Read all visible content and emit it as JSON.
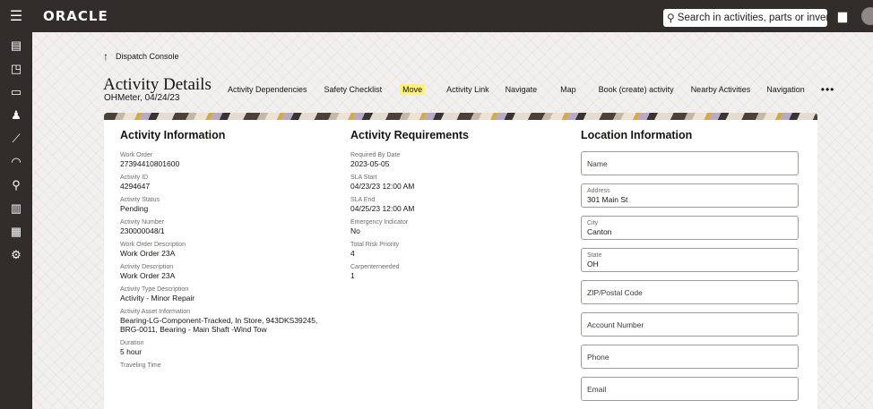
{
  "header": {
    "logo": "ORACLE",
    "search_placeholder": "Search in activities, parts or inventories"
  },
  "breadcrumb": {
    "label": "Dispatch Console"
  },
  "page": {
    "title": "Activity Details",
    "subtitle": "OHMeter, 04/24/23"
  },
  "tabs": [
    {
      "label": "Activity Dependencies"
    },
    {
      "label": "Safety Checklist"
    },
    {
      "label": "Move"
    },
    {
      "label": "Activity Link"
    },
    {
      "label": "Navigate"
    },
    {
      "label": "Map"
    },
    {
      "label": "Book (create) activity"
    },
    {
      "label": "Nearby Activities"
    },
    {
      "label": "Navigation"
    }
  ],
  "more_label": "•••",
  "activity_information": {
    "heading": "Activity Information",
    "fields": [
      {
        "label": "Work Order",
        "value": "27394410801600"
      },
      {
        "label": "Activity ID",
        "value": "4294647"
      },
      {
        "label": "Activity Status",
        "value": "Pending"
      },
      {
        "label": "Activity Number",
        "value": "230000048/1"
      },
      {
        "label": "Work Order Description",
        "value": "Work Order 23A"
      },
      {
        "label": "Activity Description",
        "value": "Work Order 23A"
      },
      {
        "label": "Activity Type Description",
        "value": "Activity - Minor Repair"
      },
      {
        "label": "Activity Asset Information",
        "value": "Bearing-LG-Component-Tracked, In Store, 943DKS39245, BRG-0011, Bearing - Main Shaft -Wind Tow"
      },
      {
        "label": "Duration",
        "value": "5 hour"
      },
      {
        "label": "Traveling Time",
        "value": ""
      }
    ]
  },
  "activity_requirements": {
    "heading": "Activity Requirements",
    "fields": [
      {
        "label": "Required By Date",
        "value": "2023-05-05"
      },
      {
        "label": "SLA Start",
        "value": "04/23/23 12:00 AM"
      },
      {
        "label": "SLA End",
        "value": "04/25/23 12:00 AM"
      },
      {
        "label": "Emergency Indicator",
        "value": "No"
      },
      {
        "label": "Total Risk Priority",
        "value": "4"
      },
      {
        "label": "Carpenterneeded",
        "value": "1"
      }
    ]
  },
  "location_information": {
    "heading": "Location Information",
    "name_placeholder": "Name",
    "address": {
      "label": "Address",
      "value": "301 Main St"
    },
    "city": {
      "label": "City",
      "value": "Canton"
    },
    "state": {
      "label": "State",
      "value": "OH"
    },
    "zip_placeholder": "ZIP/Postal Code",
    "account_placeholder": "Account Number",
    "phone_placeholder": "Phone",
    "email_placeholder": "Email"
  },
  "colors": {
    "header_bg": "#312d2a",
    "highlight": "#fff176"
  }
}
